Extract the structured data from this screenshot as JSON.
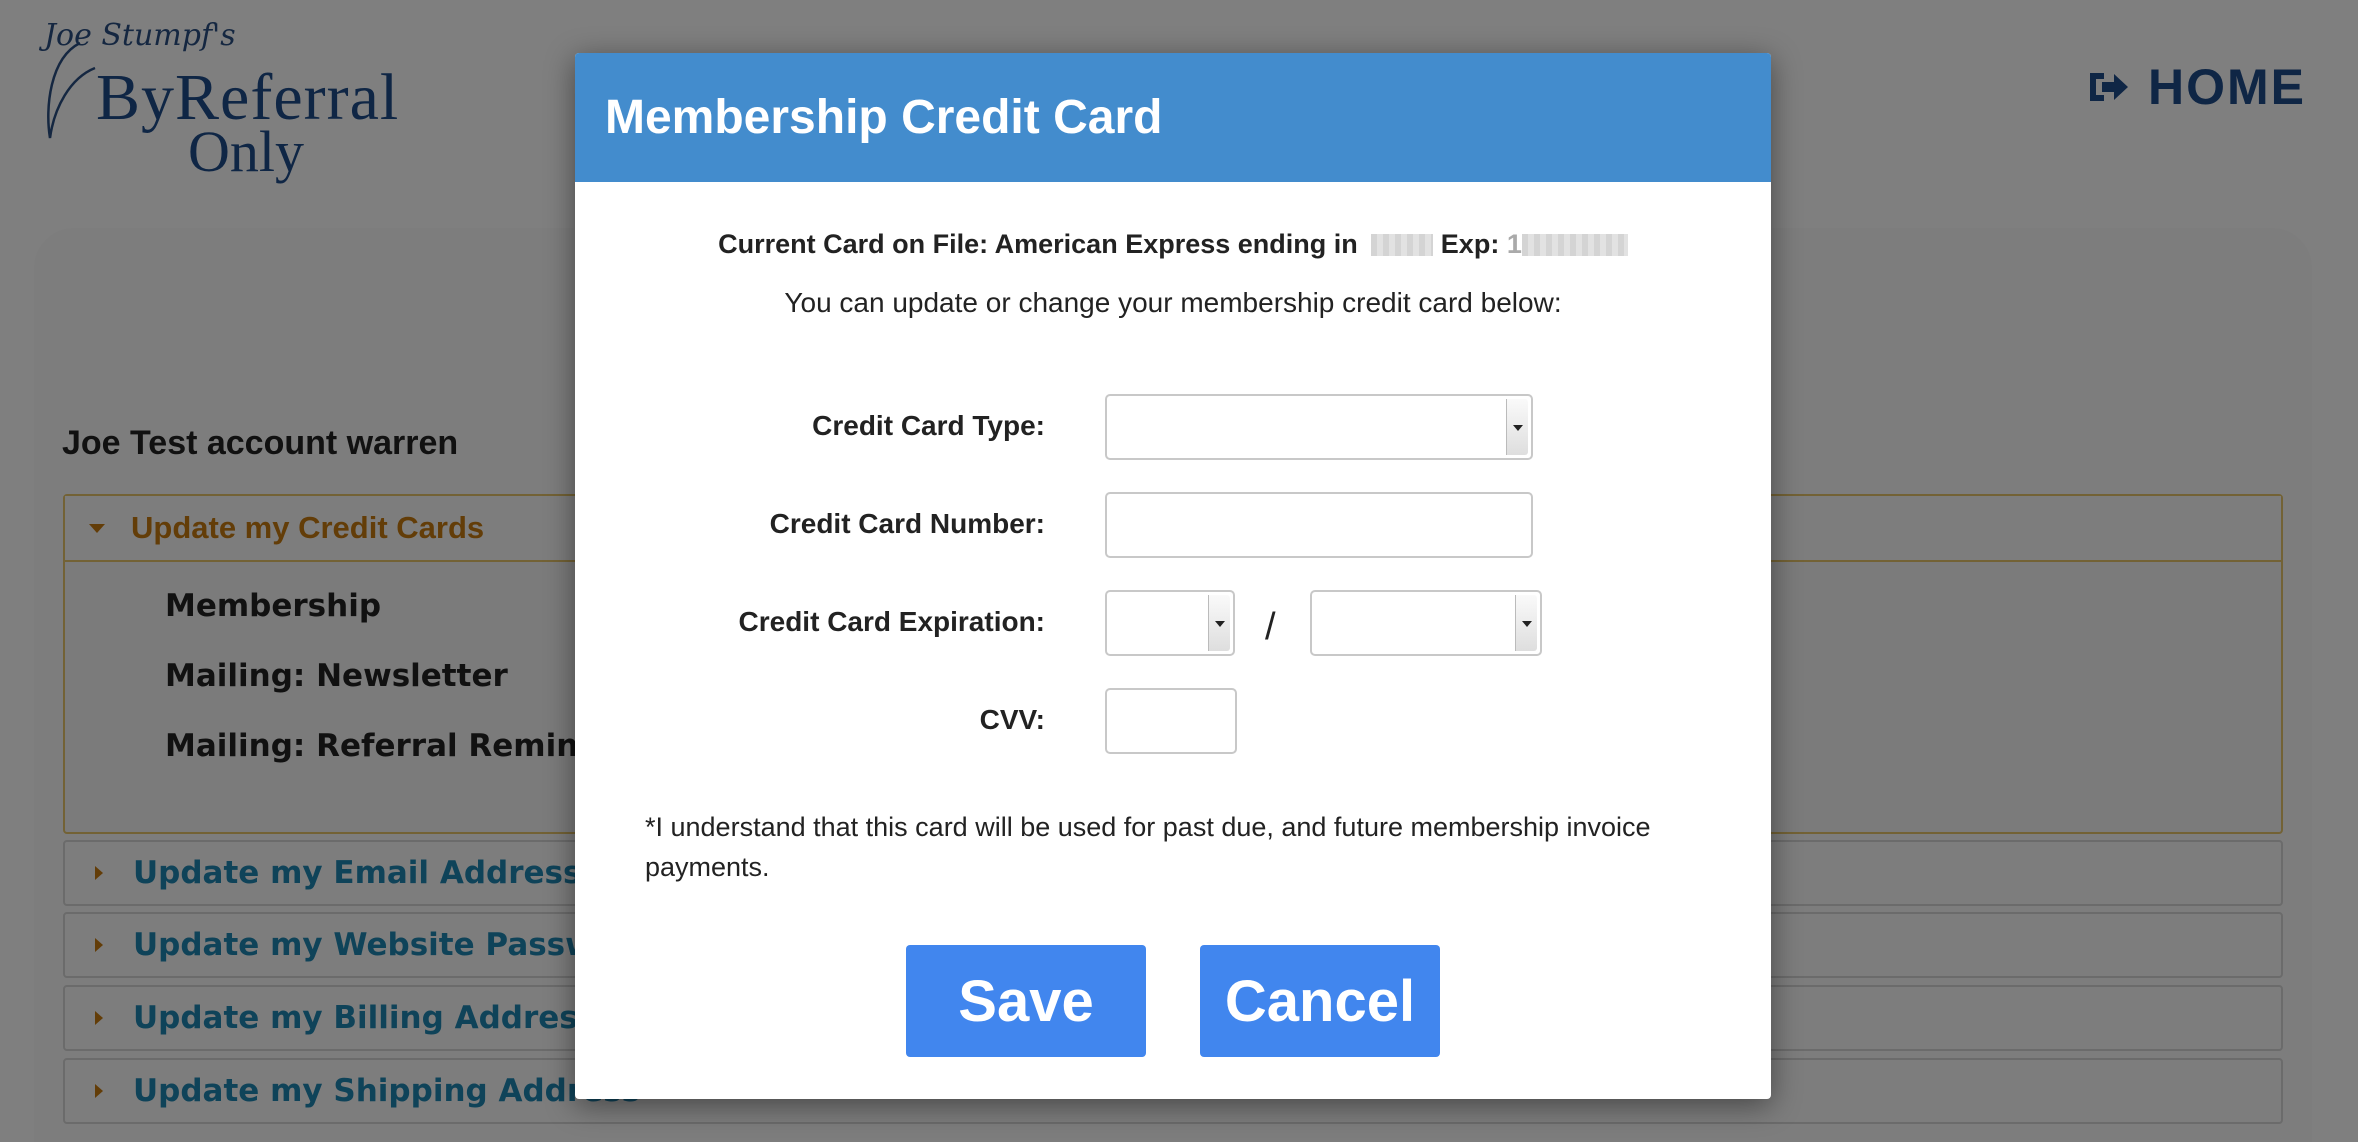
{
  "header": {
    "logo": {
      "script": "Joe Stumpf's",
      "line1": "ByReferral",
      "line2": "Only"
    },
    "home_label": "HOME"
  },
  "account": {
    "name": "Joe Test account warren",
    "open_section": {
      "label": "Update my Credit Cards",
      "items": [
        "Membership",
        "Mailing: Newsletter",
        "Mailing: Referral Reminder P"
      ]
    },
    "sections": [
      "Update my Email Address",
      "Update my Website Password",
      "Update my Billing Address",
      "Update my Shipping Address"
    ]
  },
  "modal": {
    "title": "Membership Credit Card",
    "current_card_prefix": "Current Card on File: American Express ending in",
    "exp_label": "Exp:",
    "exp_partial": "1",
    "subtitle": "You can update or change your membership credit card below:",
    "fields": {
      "card_type_label": "Credit Card Type:",
      "card_type_value": "",
      "card_number_label": "Credit Card Number:",
      "card_number_value": "",
      "expiration_label": "Credit Card Expiration:",
      "exp_month_value": "",
      "exp_year_value": "",
      "separator": "/",
      "cvv_label": "CVV:",
      "cvv_value": ""
    },
    "disclaimer": "*I understand that this card will be used for past due, and future membership invoice payments.",
    "save_label": "Save",
    "cancel_label": "Cancel"
  },
  "colors": {
    "modal_header": "#438ccd",
    "button": "#4186ee",
    "brand_navy": "#1f4c8a",
    "section_link": "#1f86b2",
    "open_section": "#c77a10"
  }
}
